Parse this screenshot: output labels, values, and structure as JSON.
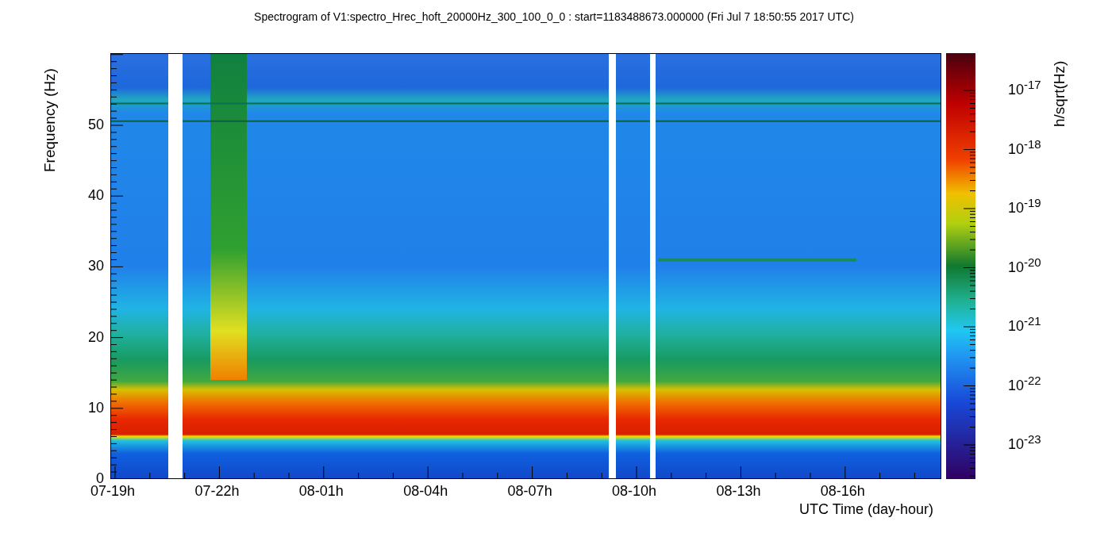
{
  "title": "Spectrogram of V1:spectro_Hrec_hoft_20000Hz_300_100_0_0 : start=1183488673.000000 (Fri Jul  7 18:50:55 2017 UTC)",
  "y_axis": {
    "label": "Frequency (Hz)",
    "ticks": [
      "50",
      "40",
      "30",
      "20",
      "10",
      "0"
    ]
  },
  "x_axis": {
    "label": "UTC Time (day-hour)",
    "ticks": [
      "07-19h",
      "07-22h",
      "08-01h",
      "08-04h",
      "08-07h",
      "08-10h",
      "08-13h",
      "08-16h"
    ]
  },
  "colorbar": {
    "label": "h/sqrt(Hz)",
    "ticks": [
      "10$^{-17}$",
      "10$^{-18}$",
      "10$^{-19}$",
      "10$^{-20}$",
      "10$^{-21}$",
      "10$^{-22}$",
      "10$^{-23}$"
    ]
  }
}
